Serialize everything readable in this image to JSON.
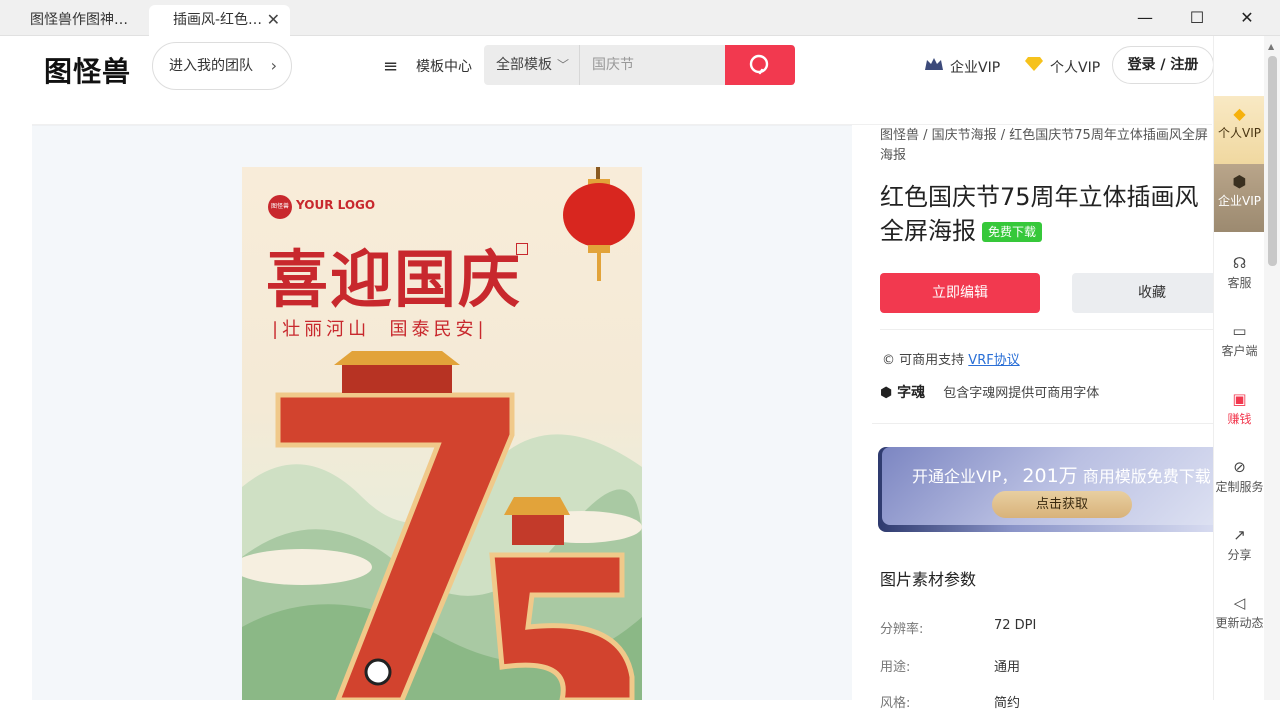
{
  "browser": {
    "tabs": [
      {
        "label": "图怪兽作图神…"
      },
      {
        "label": "插画风-红色…"
      }
    ],
    "window_controls": {
      "minimize": "—",
      "maximize": "☐",
      "close": "✕"
    }
  },
  "header": {
    "logo": "图怪兽",
    "team_button": "进入我的团队",
    "menu_icon": "≡",
    "template_center": "模板中心",
    "search": {
      "category": "全部模板",
      "placeholder": "国庆节"
    },
    "corp_vip": "企业VIP",
    "personal_vip": "个人VIP",
    "login": "登录 / 注册"
  },
  "poster": {
    "logo_badge": "图怪兽",
    "your_logo": "YOUR LOGO",
    "headline": "喜迎国庆",
    "subheadline": "|壮丽河山  国泰民安|",
    "colors": {
      "red": "#c8282d",
      "cream": "#f8ecd9",
      "mint": "#dfe8d2"
    }
  },
  "detail": {
    "breadcrumb": "图怪兽 / 国庆节海报 / 红色国庆节75周年立体插画风全屏海报",
    "title": "红色国庆节75周年立体插画风全屏海报",
    "free_badge": "免费下载",
    "edit_button": "立即编辑",
    "favorite_button": "收藏",
    "license_prefix": "可商用支持",
    "license_link": "VRF协议",
    "font_brand": "字魂",
    "font_note": "包含字魂网提供可商用字体",
    "promo": {
      "text_prefix": "开通企业VIP，",
      "count": "201万",
      "text_suffix": "商用模版免费下载",
      "button": "点击获取"
    },
    "params_title": "图片素材参数",
    "params": [
      {
        "label": "分辨率:",
        "value": "72 DPI"
      },
      {
        "label": "用途:",
        "value": "通用"
      },
      {
        "label": "风格:",
        "value": "简约"
      }
    ]
  },
  "sidebar": {
    "personal_vip": "个人VIP",
    "corp_vip": "企业VIP",
    "items": [
      {
        "label": "客服",
        "icon": "headset-icon"
      },
      {
        "label": "客户端",
        "icon": "monitor-icon"
      },
      {
        "label": "赚钱",
        "icon": "gift-icon"
      },
      {
        "label": "定制服务",
        "icon": "link-icon"
      },
      {
        "label": "分享",
        "icon": "share-icon"
      },
      {
        "label": "更新动态",
        "icon": "megaphone-icon"
      }
    ]
  },
  "theme": {
    "accent": "#f2394f",
    "free_green": "#36c83a",
    "link_blue": "#2a6fd6"
  }
}
